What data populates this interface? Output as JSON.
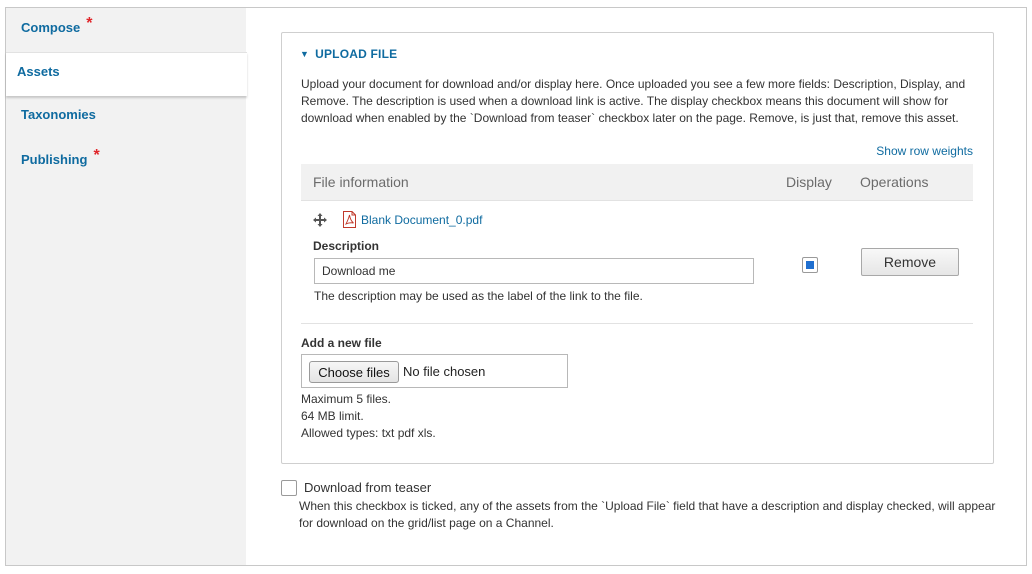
{
  "vertical_tabs": [
    {
      "label": "Compose",
      "required": "*"
    },
    {
      "label": "Assets",
      "required": ""
    },
    {
      "label": "Taxonomies",
      "required": ""
    },
    {
      "label": "Publishing",
      "required": "*"
    }
  ],
  "upload": {
    "legend": "UPLOAD FILE",
    "description": "Upload your document for download and/or display here. Once uploaded you see a few more fields: Description, Display, and Remove. The description is used when a download link is active. The display checkbox means this document will show for download when enabled by the `Download from teaser` checkbox later on the page. Remove, is just that, remove this asset.",
    "show_row_weights": "Show row weights",
    "table": {
      "headers": {
        "file": "File information",
        "display": "Display",
        "operations": "Operations"
      },
      "rows": [
        {
          "filename": "Blank Document_0.pdf",
          "description_label": "Description",
          "description_value": "Download me",
          "description_help": "The description may be used as the label of the link to the file.",
          "display_checked": true,
          "remove_label": "Remove"
        }
      ]
    },
    "add_new": {
      "label": "Add a new file",
      "choose_label": "Choose files",
      "no_file": "No file chosen",
      "limits": [
        "Maximum 5 files.",
        "64 MB limit.",
        "Allowed types: txt pdf xls."
      ]
    }
  },
  "teaser": {
    "label": "Download from teaser",
    "checked": false,
    "help": "When this checkbox is ticked, any of the assets from the `Upload File` field that have a description and display checked, will appear for download on the grid/list page on a Channel."
  },
  "colors": {
    "link": "#0f6ba0",
    "required": "#e0262a",
    "checkbox_fill": "#1f6fd0"
  },
  "icons": {
    "drag": "drag-handle-icon",
    "file": "pdf-file-icon",
    "toggle": "triangle-down-icon"
  }
}
